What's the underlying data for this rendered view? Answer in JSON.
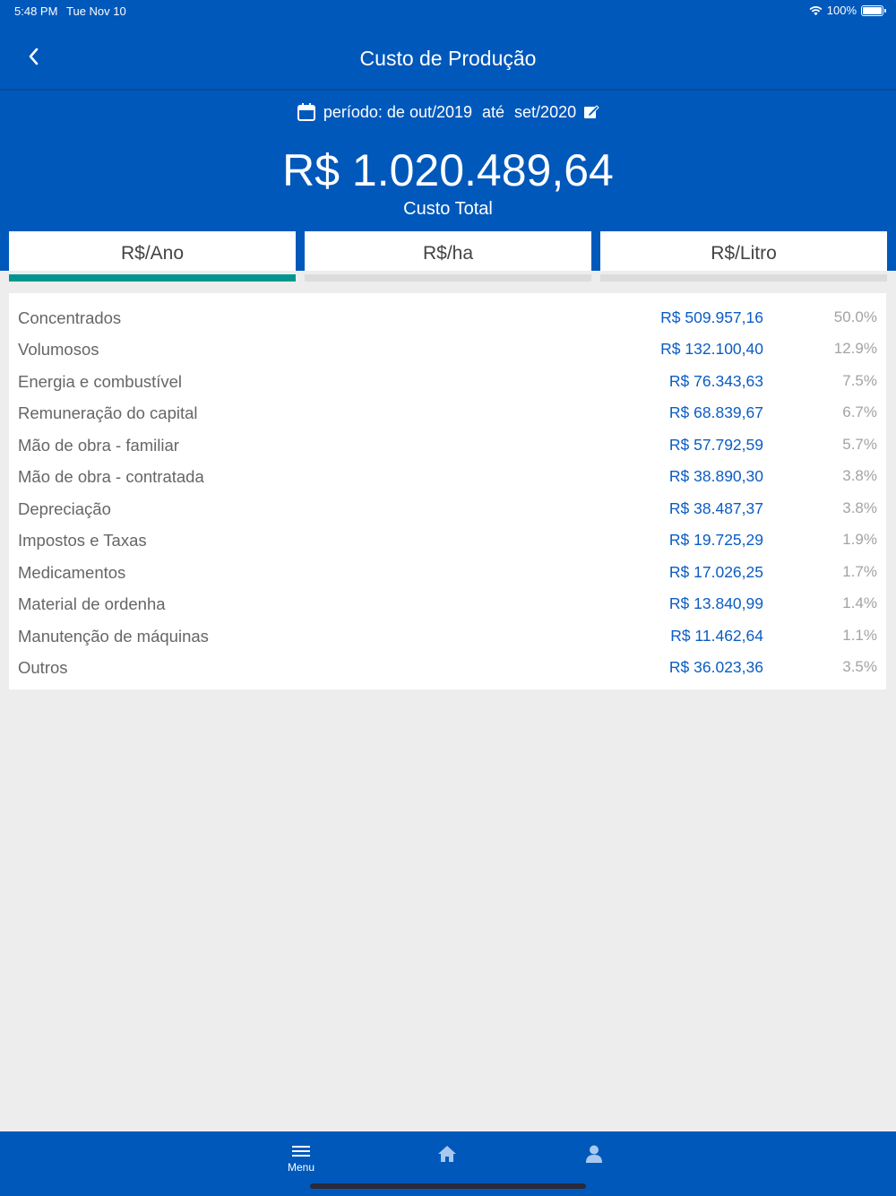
{
  "status": {
    "time": "5:48 PM",
    "date": "Tue Nov 10",
    "battery": "100%"
  },
  "nav": {
    "title": "Custo de Produção"
  },
  "period": {
    "label": "período: de out/2019",
    "sep": "até",
    "end": "set/2020"
  },
  "summary": {
    "total": "R$ 1.020.489,64",
    "label": "Custo Total"
  },
  "tabs": [
    {
      "label": "R$/Ano",
      "active": true
    },
    {
      "label": "R$/ha",
      "active": false
    },
    {
      "label": "R$/Litro",
      "active": false
    }
  ],
  "items": [
    {
      "label": "Concentrados",
      "value": "R$ 509.957,16",
      "pct": "50.0%"
    },
    {
      "label": "Volumosos",
      "value": "R$ 132.100,40",
      "pct": "12.9%"
    },
    {
      "label": "Energia e combustível",
      "value": "R$ 76.343,63",
      "pct": "7.5%"
    },
    {
      "label": "Remuneração do capital",
      "value": "R$ 68.839,67",
      "pct": "6.7%"
    },
    {
      "label": "Mão de obra - familiar",
      "value": "R$ 57.792,59",
      "pct": "5.7%"
    },
    {
      "label": "Mão de obra - contratada",
      "value": "R$ 38.890,30",
      "pct": "3.8%"
    },
    {
      "label": "Depreciação",
      "value": "R$ 38.487,37",
      "pct": "3.8%"
    },
    {
      "label": "Impostos e Taxas",
      "value": "R$ 19.725,29",
      "pct": "1.9%"
    },
    {
      "label": "Medicamentos",
      "value": "R$ 17.026,25",
      "pct": "1.7%"
    },
    {
      "label": "Material de ordenha",
      "value": "R$ 13.840,99",
      "pct": "1.4%"
    },
    {
      "label": "Manutenção de máquinas",
      "value": "R$ 11.462,64",
      "pct": "1.1%"
    },
    {
      "label": "Outros",
      "value": "R$ 36.023,36",
      "pct": "3.5%"
    }
  ],
  "bottom_nav": {
    "menu_label": "Menu"
  },
  "icons": {
    "back": "chevron-left-icon",
    "calendar": "calendar-icon",
    "edit": "edit-icon",
    "menu": "hamburger-icon",
    "home": "home-icon",
    "profile": "user-icon",
    "wifi": "wifi-icon",
    "battery": "battery-icon"
  },
  "colors": {
    "primary": "#0058bb",
    "active_tab": "#00968f",
    "value_text": "#0b5cc4",
    "background": "#ededed"
  }
}
